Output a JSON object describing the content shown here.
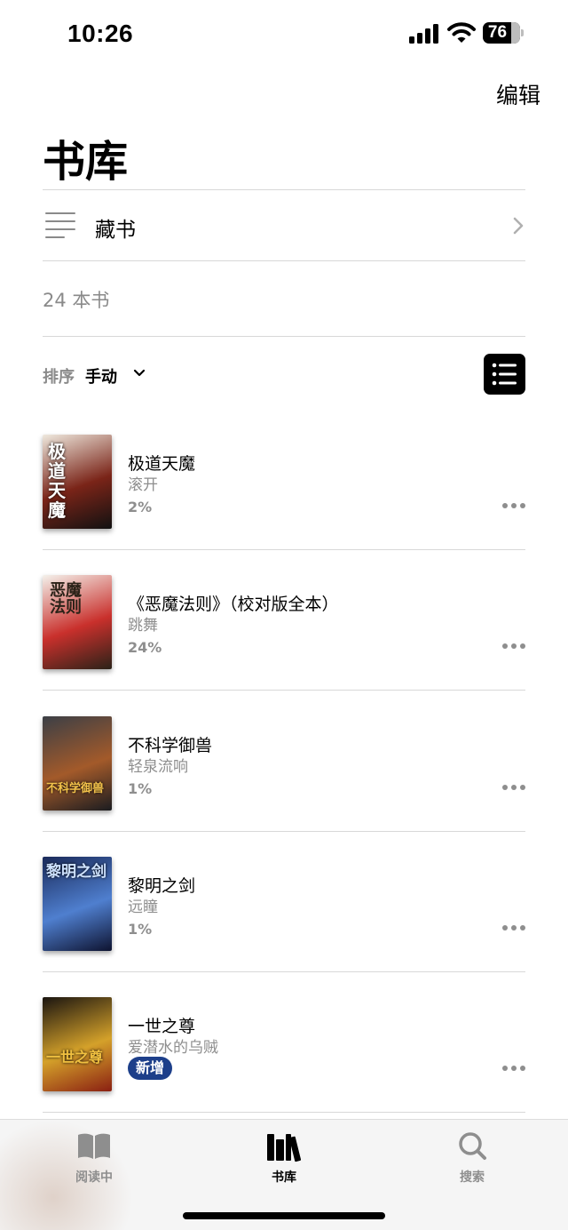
{
  "status_bar": {
    "time": "10:26",
    "battery": "76",
    "battery_level": 0.76
  },
  "header": {
    "edit_label": "编辑",
    "title": "书库"
  },
  "collection": {
    "label": "藏书"
  },
  "summary": {
    "book_count": "24 本书"
  },
  "sort": {
    "label": "排序",
    "value": "手动"
  },
  "books": [
    {
      "title": "极道天魔",
      "author": "滚开",
      "progress": "2%",
      "badge": "",
      "cover_text": "极道天魔",
      "cover_colors": [
        "#efe9de",
        "#7a2418",
        "#111111"
      ]
    },
    {
      "title": "《恶魔法则》（校对版全本）",
      "author": "跳舞",
      "progress": "24%",
      "badge": "",
      "cover_text": "恶魔法则",
      "cover_colors": [
        "#f4f2ec",
        "#c9302c",
        "#2b2218"
      ]
    },
    {
      "title": "不科学御兽",
      "author": "轻泉流响",
      "progress": "1%",
      "badge": "",
      "cover_text": "不科学御兽",
      "cover_colors": [
        "#3b3f46",
        "#a35a2a",
        "#1b1c20"
      ]
    },
    {
      "title": "黎明之剑",
      "author": "远瞳",
      "progress": "1%",
      "badge": "",
      "cover_text": "黎明之剑",
      "cover_colors": [
        "#1a2a5a",
        "#4f7fcf",
        "#0e1330"
      ]
    },
    {
      "title": "一世之尊",
      "author": "爱潜水的乌贼",
      "progress": "",
      "badge": "新增",
      "cover_text": "一世之尊",
      "cover_colors": [
        "#1a1410",
        "#d4a12a",
        "#8a1f12"
      ]
    }
  ],
  "tab_bar": {
    "tabs": [
      {
        "label": "阅读中",
        "icon": "book-open-icon",
        "active": false
      },
      {
        "label": "书库",
        "icon": "library-icon",
        "active": true
      },
      {
        "label": "搜索",
        "icon": "search-icon",
        "active": false
      }
    ]
  },
  "colors": {
    "active_tab": "#000000",
    "inactive_tab": "#8e8e8e",
    "badge": "#1d3f8a"
  }
}
